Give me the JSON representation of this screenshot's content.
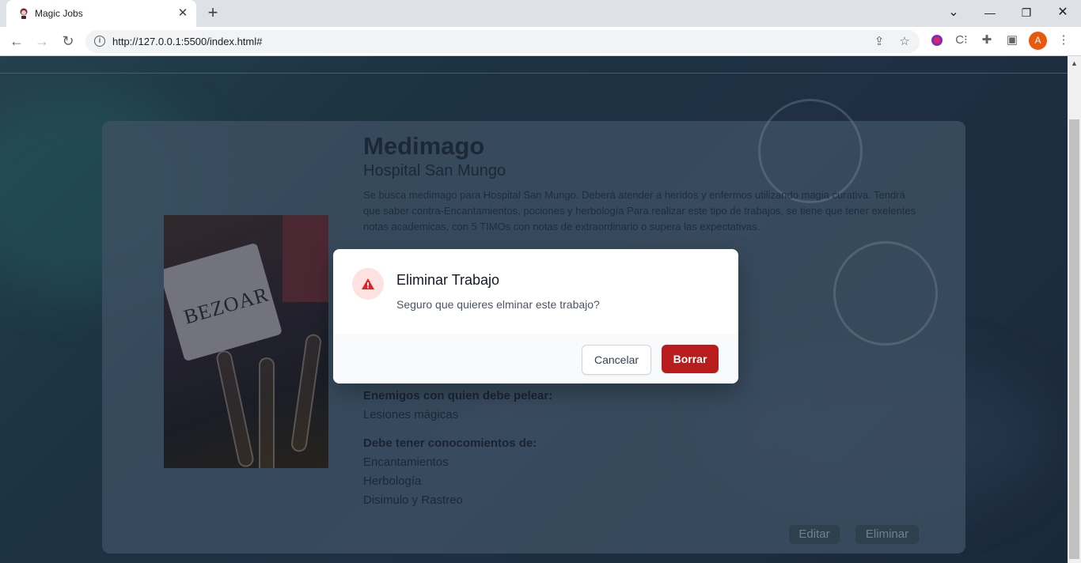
{
  "browser": {
    "tab_title": "Magic Jobs",
    "tab_close": "✕",
    "new_tab": "+",
    "url": "http://127.0.0.1:5500/index.html#",
    "profile_initial": "A",
    "window_controls": {
      "minimize": "—",
      "restore": "❐",
      "close": "✕",
      "tab_search": "⌄"
    }
  },
  "job": {
    "title": "Medimago",
    "company": "Hospital San Mungo",
    "description": "Se busca medimago para Hospital San Mungo. Deberá atender a heridos y enfermos utilizando magia curativa. Tendrá que saber contra-Encantamientos, pociones y herbología Para realizar este tipo de trabajos, se tiene que tener exelentes notas academicas, con 5 TIMOs con notas de extraordinario o supera las expectativas.",
    "image_label": "BEZOAR",
    "enemies_heading": "Enemigos con quien debe pelear:",
    "enemies": [
      "Lesiones mágicas"
    ],
    "knowledge_heading": "Debe tener conocomientos de:",
    "knowledge": [
      "Encantamientos",
      "Herbología",
      "Disimulo y Rastreo"
    ],
    "edit_label": "Editar",
    "delete_label": "Eliminar"
  },
  "modal": {
    "title": "Eliminar Trabajo",
    "message": "Seguro que quieres elminar este trabajo?",
    "cancel_label": "Cancelar",
    "confirm_label": "Borrar"
  },
  "colors": {
    "confirm": "#b91c1c",
    "warning_bg": "#fee2e2",
    "avatar": "#e8590c"
  }
}
